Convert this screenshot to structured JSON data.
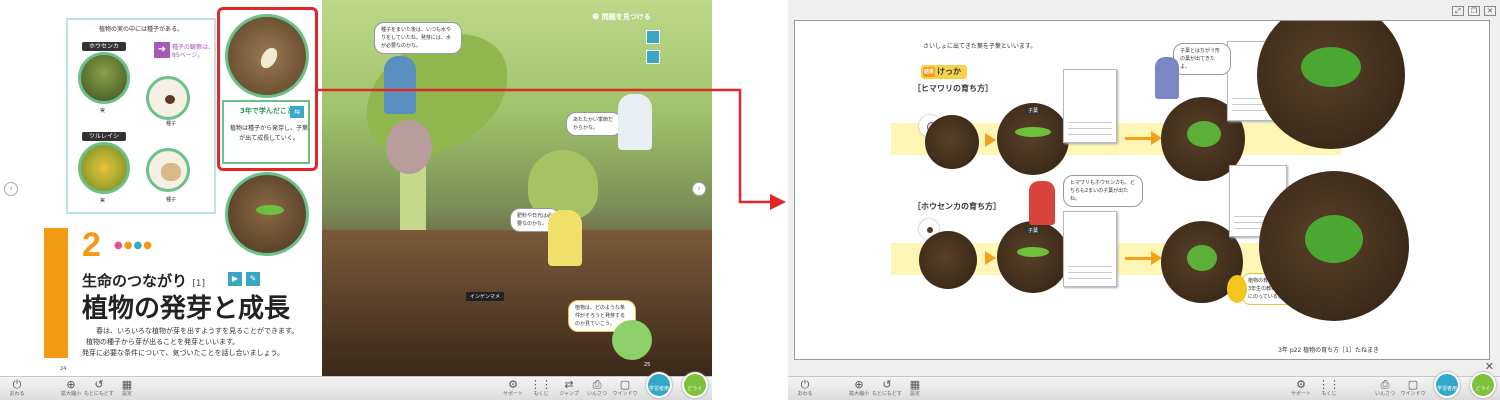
{
  "left": {
    "seed_panel": {
      "top_text": "植物の実の中には種子がある。",
      "plant1": "ホウセンカ",
      "plant1_fruit": "実",
      "plant1_seed": "種子",
      "plant2": "ツルレイシ",
      "plant2_fruit": "実",
      "plant2_seed": "種子",
      "link_text": "種子の観察は、85ページ。"
    },
    "learned": {
      "title": "3年で学んだこと",
      "body": "植物は種子から発芽し、子葉が出て成長していく。"
    },
    "chapter": {
      "number": "2",
      "subtitle": "生命のつながり",
      "subindex": "[1]",
      "title": "植物の発芽と成長",
      "intro": [
        "春は、いろいろな植物が芽を出すようすを見ることができます。",
        "植物の種子から芽が出ることを発芽といいます。",
        "発芽に必要な条件について、気づいたことを話し合いましょう。"
      ],
      "furigana": "はつが"
    },
    "photo": {
      "caption": "インゲンマメ",
      "find_problem": "問題を見つける"
    },
    "speech": {
      "s1": "種子をまいた後は、いつも水やりをしていたね。発芽には、水が必要なのかな。",
      "s2": "あたたかい季節だからかな。",
      "s3": "肥料や日光は必要なのかな。",
      "s4": "植物は、どのような条件がそろうと発芽するのか見ていこう。"
    },
    "page_numbers": {
      "left": "24",
      "right": "25"
    },
    "toolbar": {
      "items": [
        {
          "icon": "⏻",
          "label": "おわる"
        },
        {
          "icon": "⊕",
          "label": "拡大縮小"
        },
        {
          "icon": "↺",
          "label": "もとにもどす"
        },
        {
          "icon": "▦",
          "label": "設定"
        },
        {
          "icon": "⚙",
          "label": "サポート"
        },
        {
          "icon": "⋮⋮",
          "label": "もくじ"
        },
        {
          "icon": "⇄",
          "label": "ジャンプ"
        },
        {
          "icon": "⎙",
          "label": "いんさつ"
        },
        {
          "icon": "▢",
          "label": "ウインドウ"
        }
      ],
      "round1": "学習者用",
      "round2": "どうぐ"
    }
  },
  "right": {
    "top_note": "さいしょに出てきた葉を子葉といいます。",
    "result_badge": "けっか",
    "result_badge_icon": "結果",
    "himawari_head": "［ヒマワリの育ち方］",
    "housenka_head": "［ホウセンカの育ち方］",
    "leaf_label_1": "子葉",
    "leaf_label_2": "子葉",
    "speech": {
      "s1": "子葉とはちがう形の葉が出てきたよ。",
      "s2": "ヒマワリもホウセンカも、どちらも2まいの子葉が出たね。",
      "s3": "植物の育ち方は、3年生の教科書[ ]にのっているよ。"
    },
    "footer": "3年 p22 植物の育ち方［1］たねまき",
    "toolbar": {
      "items": [
        {
          "icon": "⏻",
          "label": "おわる"
        },
        {
          "icon": "⊕",
          "label": "拡大縮小"
        },
        {
          "icon": "↺",
          "label": "もとにもどす"
        },
        {
          "icon": "▦",
          "label": "設定"
        },
        {
          "icon": "⚙",
          "label": "サポート"
        },
        {
          "icon": "⋮⋮",
          "label": "もくじ"
        },
        {
          "icon": "⎙",
          "label": "いんさつ"
        },
        {
          "icon": "▢",
          "label": "ウインドウ"
        }
      ],
      "round1": "学習者用",
      "round2": "どうぐ"
    }
  },
  "colors": {
    "accent_orange": "#f39a14",
    "highlight_red": "#e0282a",
    "green_border": "#6cc08a",
    "teal": "#3aa6c1"
  }
}
